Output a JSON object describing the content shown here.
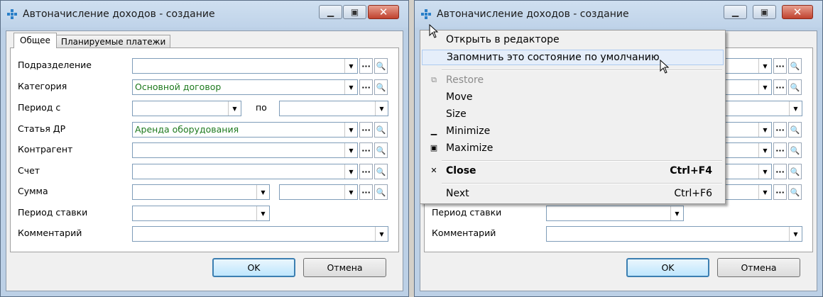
{
  "window": {
    "title": "Автоначисление доходов - создание",
    "minimize_icon": "minimize-icon",
    "maximize_icon": "maximize-icon",
    "close_symbol": "✕"
  },
  "tabs": [
    "Общее",
    "Планируемые платежи"
  ],
  "form": {
    "subdivision_label": "Подразделение",
    "subdivision_value": "",
    "category_label": "Категория",
    "category_value": "Основной договор",
    "period_from_label": "Период с",
    "period_from_value": "",
    "period_to_label": "по",
    "period_to_value": "",
    "article_label": "Статья ДР",
    "article_value": "Аренда оборудования",
    "contractor_label": "Контрагент",
    "contractor_value": "",
    "account_label": "Счет",
    "account_value": "",
    "amount_label": "Сумма",
    "amount_value": "",
    "rate_period_label": "Период ставки",
    "rate_period_value": "",
    "comment_label": "Комментарий",
    "comment_value": ""
  },
  "buttons": {
    "ok": "OK",
    "cancel": "Отмена",
    "ellipsis": "···",
    "magnifier_icon": "magnifier-icon",
    "dropdown_icon": "chevron-down-icon"
  },
  "context_menu": {
    "open_in_editor": "Открыть в редакторе",
    "remember_state": "Запомнить это состояние по умолчанию",
    "restore": "Restore",
    "move": "Move",
    "size": "Size",
    "minimize": "Minimize",
    "maximize": "Maximize",
    "close": "Close",
    "close_shortcut": "Ctrl+F4",
    "next": "Next",
    "next_shortcut": "Ctrl+F6"
  },
  "colors": {
    "green_value_text": "#1e7a1e",
    "title_bar": "#bfd3e9",
    "close_button": "#c0422e",
    "app_icon": "#2a7fc8"
  }
}
